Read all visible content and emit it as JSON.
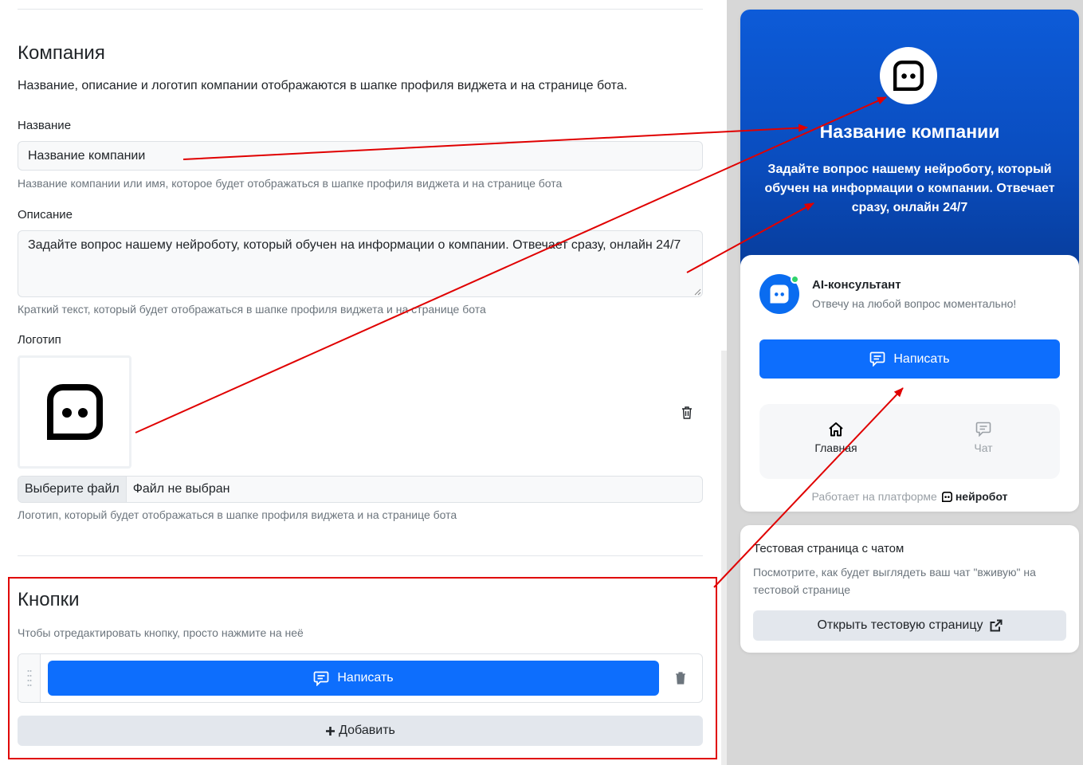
{
  "company": {
    "title": "Компания",
    "intro": "Название, описание и логотип компании отображаются в шапке профиля виджета и на странице бота.",
    "name_label": "Название",
    "name_value": "Название компании",
    "name_help": "Название компании или имя, которое будет отображаться в шапке профиля виджета и на странице бота",
    "desc_label": "Описание",
    "desc_value": "Задайте вопрос нашему нейроботу, который обучен на информации о компании. Отвечает сразу, онлайн 24/7",
    "desc_help": "Краткий текст, который будет отображаться в шапке профиля виджета и на странице бота",
    "logo_label": "Логотип",
    "file_button": "Выберите файл",
    "file_status": "Файл не выбран",
    "logo_help": "Логотип, который будет отображаться в шапке профиля виджета и на странице бота"
  },
  "buttons": {
    "title": "Кнопки",
    "hint": "Чтобы отредактировать кнопку, просто нажмите на неё",
    "items": [
      {
        "label": "Написать",
        "icon": "chat-icon"
      }
    ],
    "add_label": "Добавить"
  },
  "widget": {
    "company_name": "Название компании",
    "company_desc": "Задайте вопрос нашему нейроботу, который обучен на информации о компании. Отвечает сразу, онлайн 24/7",
    "bot_name": "AI-консультант",
    "bot_subtitle": "Отвечу на любой вопрос моментально!",
    "write_button": "Написать",
    "nav": [
      {
        "label": "Главная",
        "icon": "home-icon"
      },
      {
        "label": "Чат",
        "icon": "chat-icon"
      }
    ],
    "powered_by": "Работает на платформе",
    "brand": "нейробот"
  },
  "test_page": {
    "title": "Тестовая страница с чатом",
    "description": "Посмотрите, как будет выглядеть ваш чат \"вживую\" на тестовой странице",
    "button": "Открыть тестовую страницу"
  },
  "colors": {
    "accent": "#0d6efd",
    "annotation": "#e00000",
    "online": "#2fd36b"
  }
}
